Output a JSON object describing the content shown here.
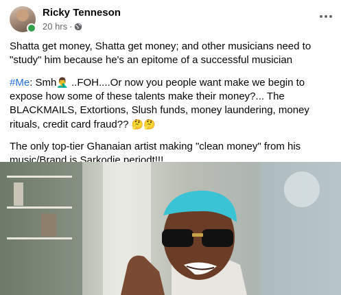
{
  "post": {
    "author": "Ricky Tenneson",
    "time": "20 hrs",
    "separator": "·",
    "icons": {
      "privacy": "globe-icon",
      "more": "more-horizontal-icon",
      "online": "online-dot"
    },
    "paragraph1": "Shatta get money, Shatta get money; and other musicians need to \"study\" him because he's an epitome of a successful musician",
    "paragraph2": {
      "hashtag": "#Me",
      "text_before_emoji": ": Smh",
      "emoji1": "🤦‍♂️",
      "text_after_emoji": " ..FOH....Or now you people want make we begin to expose how some of these talents make their money?... The BLACKMAILS, Extortions, Slush funds, money laundering, money rituals, credit card fraud?? ",
      "emoji2": "🤔🤔"
    },
    "paragraph3": "The only top-tier Ghanaian artist making \"clean money\" from his music/Brand is Sarkodie periodt!!!",
    "photo": {
      "accent": "#39c3d4"
    }
  }
}
